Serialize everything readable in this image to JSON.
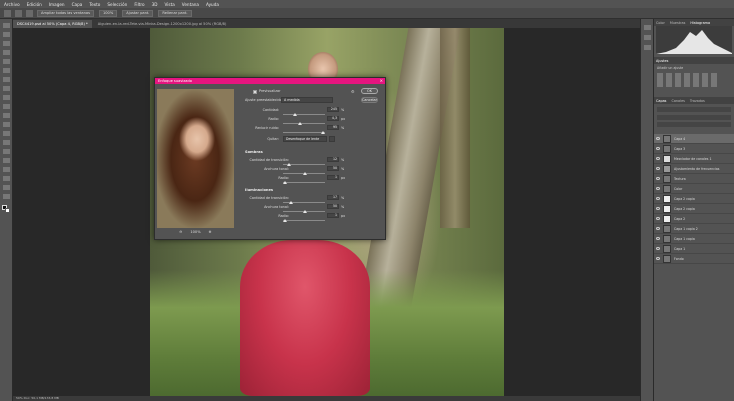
{
  "menu": [
    "Archivo",
    "Edición",
    "Imagen",
    "Capa",
    "Texto",
    "Selección",
    "Filtro",
    "3D",
    "Vista",
    "Ventana",
    "Ayuda"
  ],
  "options": {
    "sample_label": "Ampliar todas las ventanas",
    "zoom_label": "100%",
    "fit_label": "Ajustar pant.",
    "fill_label": "Rellenar pant."
  },
  "tabs": [
    {
      "label": "DSC4419.psd al 50% (Capa 4, RGB/8) *",
      "active": true
    },
    {
      "label": "Alguien-en-la-red-Tete-via-Minka-Design-1200x1200.jpg al 50% (RGB/8)",
      "active": false
    }
  ],
  "dialog": {
    "title": "Enfoque suavizado",
    "close": "×",
    "preview_checkbox": "Previsualizar",
    "ok": "OK",
    "cancel": "Cancelar",
    "preset_label": "Ajuste preestablecido:",
    "preset_value": "A medida",
    "zoom": "100%",
    "amount": {
      "label": "Cantidad:",
      "value": "245",
      "unit": "%"
    },
    "radius": {
      "label": "Radio:",
      "value": "4,3",
      "unit": "px"
    },
    "noise": {
      "label": "Reducir ruido:",
      "value": "95",
      "unit": "%"
    },
    "remove": {
      "label": "Quitar:",
      "value": "Desenfoque de lente"
    },
    "shadows": {
      "title": "Sombras",
      "fade": {
        "label": "Cantidad de transición:",
        "value": "12",
        "unit": "%"
      },
      "tonal": {
        "label": "Anchura tonal:",
        "value": "50",
        "unit": "%"
      },
      "radius": {
        "label": "Radio:",
        "value": "1",
        "unit": "px"
      }
    },
    "highlights": {
      "title": "Iluminaciones",
      "fade": {
        "label": "Cantidad de transición:",
        "value": "17",
        "unit": "%"
      },
      "tonal": {
        "label": "Anchura tonal:",
        "value": "50",
        "unit": "%"
      },
      "radius": {
        "label": "Radio:",
        "value": "1",
        "unit": "px"
      }
    }
  },
  "panels": {
    "top_tabs": [
      "Color",
      "Muestras",
      "Histograma"
    ],
    "adjust_tabs": [
      "Ajustes"
    ],
    "adjust_hint": "Añadir un ajuste",
    "layer_tabs": [
      "Capas",
      "Canales",
      "Trazados"
    ],
    "layers": [
      "Capa 4",
      "Capa 3",
      "Mezclador de canales 1",
      "Ajustamiento de frecuencias",
      "Textura",
      "Color",
      "Capa 2 copia",
      "Capa 2 copia",
      "Capa 2",
      "Capa 1 copia 2",
      "Capa 1 copia",
      "Capa 1",
      "Fondo"
    ]
  },
  "status": "50%   Doc: 50,1 MB/133,8 MB"
}
